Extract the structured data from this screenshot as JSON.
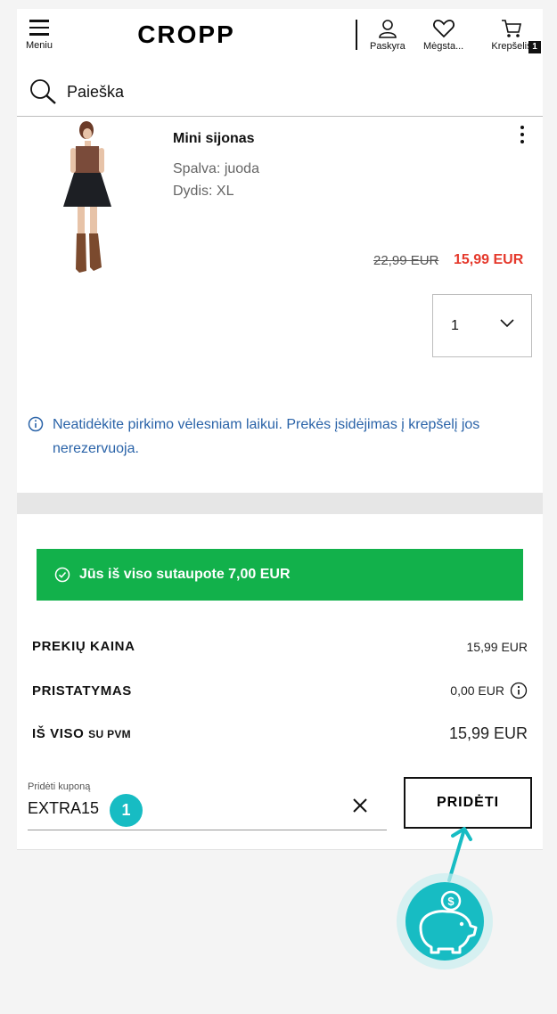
{
  "header": {
    "menu_label": "Meniu",
    "logo_text": "CROPP",
    "account_label": "Paskyra",
    "favorites_label": "Mėgsta...",
    "cart_label": "Krepšelis",
    "cart_count": "1",
    "search_label": "Paieška"
  },
  "product": {
    "name": "Mini sijonas",
    "color": "Spalva: juoda",
    "size": "Dydis: XL",
    "old_price": "22,99 EUR",
    "new_price": "15,99 EUR",
    "quantity": "1",
    "notice": "Neatidėkite pirkimo vėlesniam laikui. Prekės įsidėjimas į krepšelį jos nerezervuoja."
  },
  "summary": {
    "savings": "Jūs iš viso sutaupote 7,00 EUR",
    "items_label": "PREKIŲ KAINA",
    "items_value": "15,99 EUR",
    "delivery_label": "PRISTATYMAS",
    "delivery_value": "0,00 EUR",
    "total_label": "IŠ VISO",
    "total_suffix": "SU PVM",
    "total_value": "15,99 EUR"
  },
  "coupon": {
    "label": "Pridėti kuponą",
    "value": "EXTRA15",
    "add_button": "PRIDĖTI",
    "step_number": "1"
  },
  "colors": {
    "sale_red": "#e5392c",
    "savings_green": "#12b14b",
    "notice_blue": "#2a63a8",
    "annotation_teal": "#17bcc3"
  }
}
